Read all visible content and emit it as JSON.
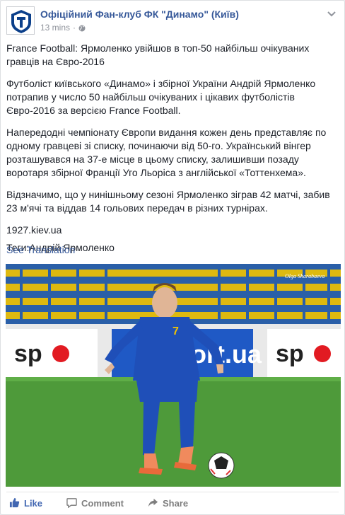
{
  "post": {
    "page_name": "Офіційний Фан-клуб ФК \"Динамо\" (Київ)",
    "timestamp": "13 mins",
    "dot": "·",
    "paragraphs": [
      "France Football: Ярмоленко увійшов в топ-50 найбільш очікуваних гравців на Євро-2016",
      "Футболіст київського «Динамо» і збірної України Андрій Ярмоленко потрапив у число 50 найбільш очікуваних і цікавих футболістів Євро-2016 за версією France Football.",
      "Напередодні чемпіонату Європи видання кожен день представляє по одному гравцеві зі списку, починаючи від 50-го. Український вінгер розташувався на 37-е місце в цьому списку, залишивши позаду воротаря збірної Франції Уго Льоріса з англійської «Тоттенхема».",
      "Відзначимо, що у нинішньому сезоні Ярмоленко зіграв 42 матчі, забив 23 м'ячі та віддав 14 гольових передач в різних турнірах."
    ],
    "source": "1927.kiev.ua",
    "tags": "Теги:Андрій Ярмоленко",
    "see_translation": "See Translation"
  },
  "photo": {
    "ad_text": "sport.ua",
    "jersey_number": "7",
    "watermark": "Olga Sharabaeva"
  },
  "actions": {
    "like": "Like",
    "comment": "Comment",
    "share": "Share"
  },
  "colors": {
    "link": "#365899",
    "like_blue": "#4267b2",
    "text": "#1d2129",
    "meta": "#90949c",
    "jersey": "#1f4fb8",
    "seats": "#f2c300"
  },
  "icons": [
    "globe-icon",
    "chevron-down-icon",
    "like-icon",
    "comment-icon",
    "share-icon"
  ]
}
